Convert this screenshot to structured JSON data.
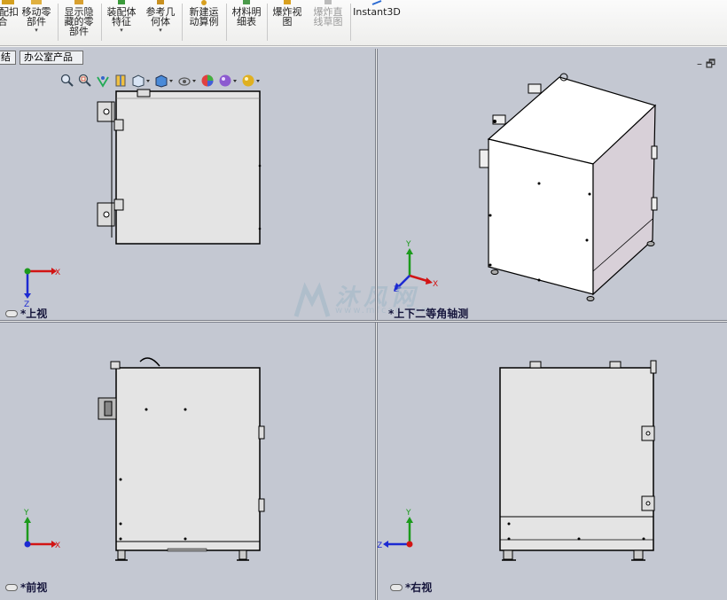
{
  "ribbon": {
    "buttons": [
      {
        "label": "装配扣\n合",
        "clip": true
      },
      {
        "label": "移动零\n部件",
        "dropdown": true
      },
      {
        "label": "显示隐\n藏的零\n部件"
      },
      {
        "label": "装配体\n特征",
        "dropdown": true
      },
      {
        "label": "参考几\n何体",
        "dropdown": true
      },
      {
        "label": "新建运\n动算例"
      },
      {
        "label": "材料明\n细表"
      },
      {
        "label": "爆炸视\n图"
      },
      {
        "label": "爆炸直\n线草图",
        "disabled": true
      },
      {
        "label": "Instant3D"
      }
    ]
  },
  "tabs": [
    "结",
    "办公室产品"
  ],
  "window_controls": "– 🗗",
  "viewports": {
    "top_left": {
      "label": "*上视",
      "axes": [
        "X",
        "Z"
      ]
    },
    "top_right": {
      "label": "*上下二等角轴测",
      "axes": [
        "Y",
        "X",
        "Z"
      ]
    },
    "bottom_left": {
      "label": "*前视",
      "axes": [
        "Y",
        "X"
      ]
    },
    "bottom_right": {
      "label": "*右视",
      "axes": [
        "Y",
        "Z"
      ]
    }
  },
  "watermark": {
    "text": "沐风网",
    "url": "www.mfcad.com"
  },
  "colors": {
    "background": "#c4c8d2",
    "x_axis": "#d21414",
    "y_axis": "#1c9a1c",
    "z_axis": "#1c2ad2"
  }
}
